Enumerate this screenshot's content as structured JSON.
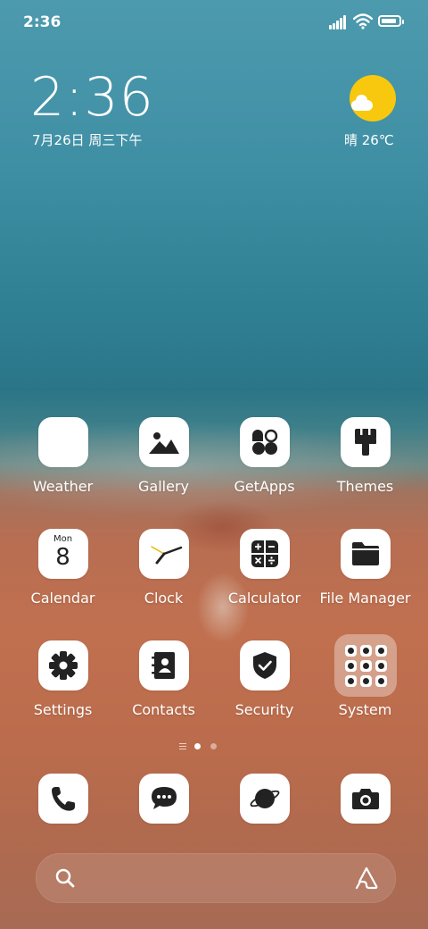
{
  "status_bar": {
    "time": "2:36",
    "battery_level": 0.9
  },
  "clock_widget": {
    "time": "2:36",
    "date": "7月26日 周三下午"
  },
  "weather_widget": {
    "condition_temp": "晴 26℃",
    "sun_color": "#f8c80e"
  },
  "apps": {
    "row1": [
      {
        "label": "Weather"
      },
      {
        "label": "Gallery"
      },
      {
        "label": "GetApps"
      },
      {
        "label": "Themes"
      }
    ],
    "row2": [
      {
        "label": "Calendar",
        "icon_day": "Mon",
        "icon_date": "8"
      },
      {
        "label": "Clock"
      },
      {
        "label": "Calculator"
      },
      {
        "label": "File Manager"
      }
    ],
    "row3": [
      {
        "label": "Settings"
      },
      {
        "label": "Contacts"
      },
      {
        "label": "Security"
      },
      {
        "label": "System"
      }
    ]
  },
  "page_indicator": {
    "pages": 2,
    "active_page": 1
  },
  "dock": [
    {
      "icon": "phone-icon"
    },
    {
      "icon": "messaging-icon"
    },
    {
      "icon": "browser-icon"
    },
    {
      "icon": "camera-icon"
    }
  ],
  "search_bar": {
    "placeholder": ""
  },
  "icon_color": "#222222"
}
